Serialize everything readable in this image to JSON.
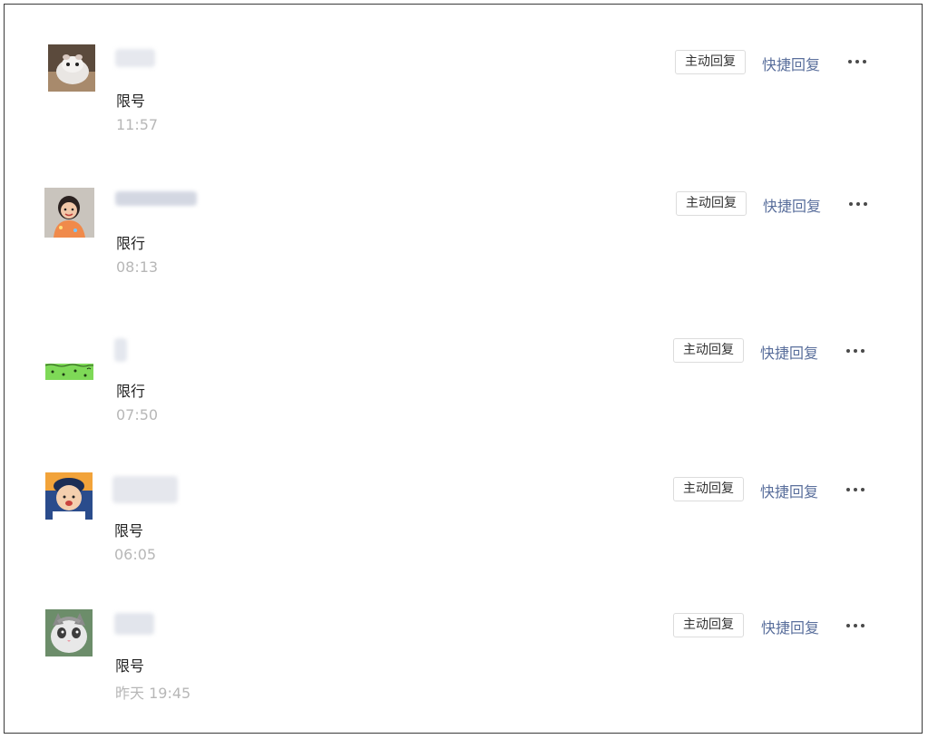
{
  "colors": {
    "quick_reply": "#5a6f9c",
    "time_text": "#b7b7b7",
    "message_text": "#222222",
    "button_border": "#dcdcdc",
    "name_placeholder": "#dde0e8"
  },
  "conversations": [
    {
      "avatar_icon": "hamster-avatar-icon",
      "message": "限号",
      "time": "11:57",
      "active_reply_label": "主动回复",
      "quick_reply_label": "快捷回复",
      "more_icon": "more-dots-icon"
    },
    {
      "avatar_icon": "child-photo-avatar-icon",
      "message": "限行",
      "time": "08:13",
      "active_reply_label": "主动回复",
      "quick_reply_label": "快捷回复",
      "more_icon": "more-dots-icon"
    },
    {
      "avatar_icon": "green-pattern-avatar-icon",
      "message": "限行",
      "time": "07:50",
      "active_reply_label": "主动回复",
      "quick_reply_label": "快捷回复",
      "more_icon": "more-dots-icon"
    },
    {
      "avatar_icon": "toddler-photo-avatar-icon",
      "message": "限号",
      "time": "06:05",
      "active_reply_label": "主动回复",
      "quick_reply_label": "快捷回复",
      "more_icon": "more-dots-icon"
    },
    {
      "avatar_icon": "cat-avatar-icon",
      "message": "限号",
      "time": "昨天 19:45",
      "active_reply_label": "主动回复",
      "quick_reply_label": "快捷回复",
      "more_icon": "more-dots-icon"
    }
  ]
}
